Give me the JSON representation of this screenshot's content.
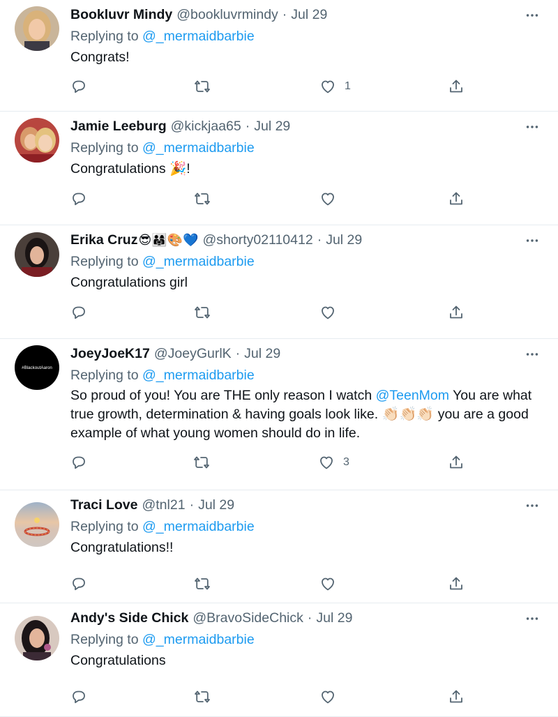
{
  "reply_prefix": "Replying to",
  "tweets": [
    {
      "name": "Bookluvr Mindy",
      "handle": "@bookluvrmindy",
      "separator": "·",
      "date": "Jul 29",
      "reply_to": "@_mermaidbarbie",
      "text": "Congrats!",
      "likes": "1"
    },
    {
      "name": "Jamie Leeburg",
      "handle": "@kickjaa65",
      "separator": "·",
      "date": "Jul 29",
      "reply_to": "@_mermaidbarbie",
      "text": "Congratulations",
      "text_emoji": "🎉",
      "text_suffix": "!",
      "likes": ""
    },
    {
      "name": "Erika Cruz",
      "name_emojis": "😎👨‍👩‍👧🎨💙",
      "handle": "@shorty02110412",
      "separator": "·",
      "date": "Jul 29",
      "reply_to": "@_mermaidbarbie",
      "text": "Congratulations girl",
      "likes": ""
    },
    {
      "name": "JoeyJoeK17",
      "handle": "@JoeyGurlK",
      "separator": "·",
      "date": "Jul 29",
      "reply_to": "@_mermaidbarbie",
      "avatar_text": "#BlackoutAaron",
      "text_part1": "So proud of you! You are THE only reason I watch ",
      "text_mention": "@TeenMom",
      "text_part2": " You are what true growth, determination & having goals look like. ",
      "text_emoji": "👏🏻👏🏻👏🏻",
      "text_part3": " you are a good example of what young women should do in life.",
      "likes": "3"
    },
    {
      "name": "Traci Love",
      "handle": "@tnl21",
      "separator": "·",
      "date": "Jul 29",
      "reply_to": "@_mermaidbarbie",
      "text": "Congratulations!!",
      "likes": ""
    },
    {
      "name": "Andy's Side Chick",
      "handle": "@BravoSideChick",
      "separator": "·",
      "date": "Jul 29",
      "reply_to": "@_mermaidbarbie",
      "text": "Congratulations",
      "likes": ""
    }
  ],
  "colors": {
    "link": "#1d9bf0",
    "secondary_text": "#536471",
    "primary_text": "#0f1419",
    "divider": "#e6ecf0"
  },
  "icons": {
    "reply": "speech-bubble-icon",
    "retweet": "retweet-arrows-icon",
    "like": "heart-outline-icon",
    "share": "share-upload-icon",
    "more": "ellipsis-horizontal-icon"
  }
}
